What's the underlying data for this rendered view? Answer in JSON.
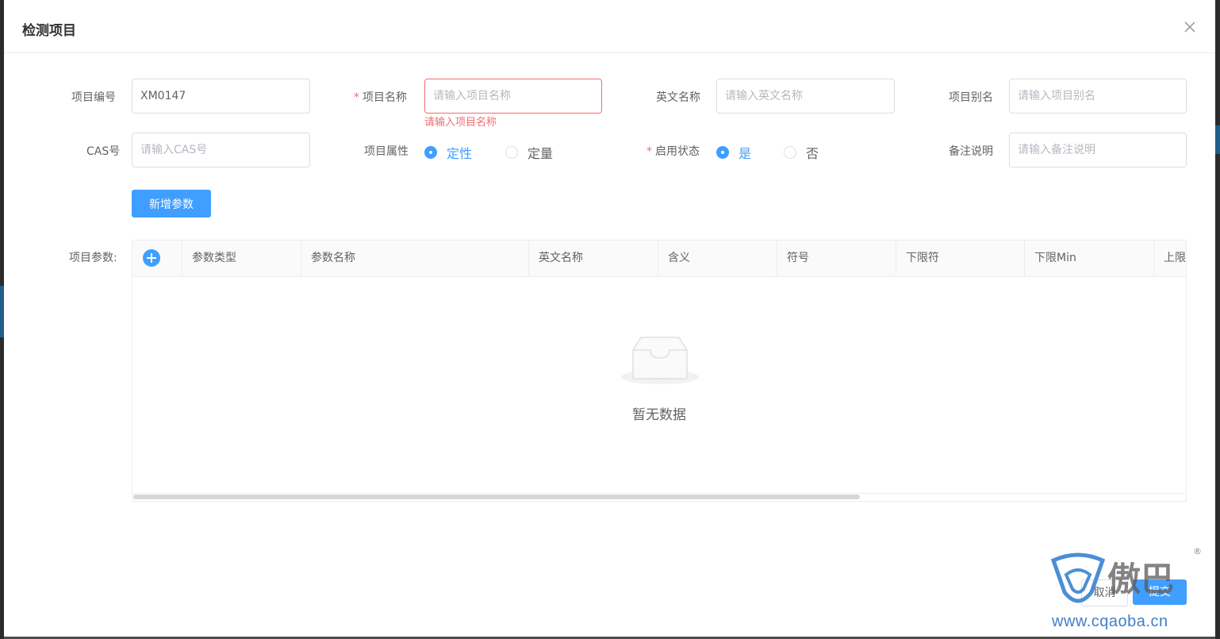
{
  "dialog": {
    "title": "检测项目"
  },
  "form": {
    "code": {
      "label": "项目编号",
      "value": "XM0147"
    },
    "name": {
      "label": "项目名称",
      "placeholder": "请输入项目名称",
      "error": "请输入项目名称"
    },
    "english_name": {
      "label": "英文名称",
      "placeholder": "请输入英文名称"
    },
    "alias": {
      "label": "项目别名",
      "placeholder": "请输入项目别名"
    },
    "cas": {
      "label": "CAS号",
      "placeholder": "请输入CAS号"
    },
    "attribute": {
      "label": "项目属性",
      "options": [
        "定性",
        "定量"
      ],
      "selected": "定性"
    },
    "status": {
      "label": "启用状态",
      "options": [
        "是",
        "否"
      ],
      "selected": "是"
    },
    "remark": {
      "label": "备注说明",
      "placeholder": "请输入备注说明"
    },
    "add_param_button": "新增参数",
    "params_label": "项目参数:"
  },
  "table": {
    "columns": [
      "参数类型",
      "参数名称",
      "英文名称",
      "含义",
      "符号",
      "下限符",
      "下限Min",
      "上限"
    ],
    "empty_text": "暂无数据"
  },
  "footer": {
    "cancel": "取消",
    "submit": "提交"
  },
  "watermark": {
    "brand": "傲巴",
    "url": "www.cqaoba.cn",
    "reg": "®"
  },
  "colors": {
    "primary": "#409eff",
    "error": "#f56c6c"
  }
}
